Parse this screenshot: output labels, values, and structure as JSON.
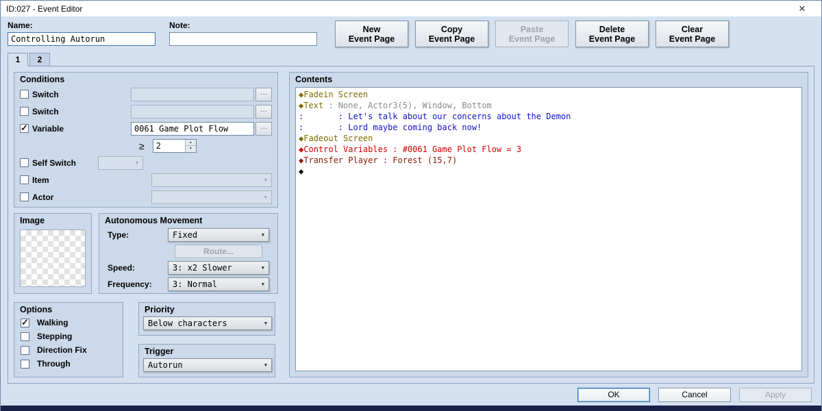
{
  "window": {
    "title": "ID:027 - Event Editor"
  },
  "icons": {
    "close": "✕",
    "dropdown_arrow": "▼",
    "spin_up": "▲",
    "spin_down": "▼",
    "more": "···"
  },
  "header": {
    "name_label": "Name:",
    "name_value": "Controlling Autorun",
    "note_label": "Note:",
    "note_value": ""
  },
  "page_buttons": [
    {
      "line1": "New",
      "line2": "Event Page",
      "enabled": true
    },
    {
      "line1": "Copy",
      "line2": "Event Page",
      "enabled": true
    },
    {
      "line1": "Paste",
      "line2": "Event Page",
      "enabled": false
    },
    {
      "line1": "Delete",
      "line2": "Event Page",
      "enabled": true
    },
    {
      "line1": "Clear",
      "line2": "Event Page",
      "enabled": true
    }
  ],
  "tabs": [
    {
      "label": "1",
      "active": true
    },
    {
      "label": "2",
      "active": false
    }
  ],
  "conditions": {
    "title": "Conditions",
    "switch1": {
      "label": "Switch",
      "checked": false,
      "value": ""
    },
    "switch2": {
      "label": "Switch",
      "checked": false,
      "value": ""
    },
    "variable": {
      "label": "Variable",
      "checked": true,
      "value": "0061 Game Plot Flow"
    },
    "comparison": {
      "operator": "≥",
      "value": "2"
    },
    "self_switch": {
      "label": "Self Switch",
      "checked": false,
      "value": ""
    },
    "item": {
      "label": "Item",
      "checked": false,
      "value": ""
    },
    "actor": {
      "label": "Actor",
      "checked": false,
      "value": ""
    }
  },
  "image": {
    "title": "Image"
  },
  "movement": {
    "title": "Autonomous Movement",
    "type_label": "Type:",
    "type_value": "Fixed",
    "route_button": "Route...",
    "speed_label": "Speed:",
    "speed_value": "3: x2 Slower",
    "frequency_label": "Frequency:",
    "frequency_value": "3: Normal"
  },
  "options": {
    "title": "Options",
    "items": [
      {
        "label": "Walking",
        "checked": true
      },
      {
        "label": "Stepping",
        "checked": false
      },
      {
        "label": "Direction Fix",
        "checked": false
      },
      {
        "label": "Through",
        "checked": false
      }
    ]
  },
  "priority": {
    "title": "Priority",
    "value": "Below characters"
  },
  "trigger": {
    "title": "Trigger",
    "value": "Autorun"
  },
  "contents": {
    "title": "Contents",
    "colors": {
      "command": "#7d6a00",
      "param": "#8a8a8a",
      "message": "#1212cc",
      "variable": "#d40000",
      "transfer": "#8b1a00",
      "plain": "#000000"
    },
    "lines": [
      {
        "segments": [
          {
            "text": "◆Fadein Screen",
            "color": "command"
          }
        ]
      },
      {
        "segments": [
          {
            "text": "◆Text",
            "color": "command"
          },
          {
            "text": " : None, Actor3(5), Window, Bottom",
            "color": "param"
          }
        ]
      },
      {
        "segments": [
          {
            "text": ":       : Let's talk about our concerns about the Demon",
            "color": "message"
          }
        ]
      },
      {
        "segments": [
          {
            "text": ":       : Lord maybe coming back now!",
            "color": "message"
          }
        ]
      },
      {
        "segments": [
          {
            "text": "◆Fadeout Screen",
            "color": "command"
          }
        ]
      },
      {
        "segments": [
          {
            "text": "◆Control Variables : #0061 Game Plot Flow = 3",
            "color": "variable"
          }
        ]
      },
      {
        "segments": [
          {
            "text": "◆Transfer Player : Forest (15,7)",
            "color": "transfer"
          }
        ]
      },
      {
        "segments": [
          {
            "text": "◆",
            "color": "plain"
          }
        ]
      }
    ]
  },
  "footer": {
    "ok": "OK",
    "cancel": "Cancel",
    "apply": "Apply"
  }
}
